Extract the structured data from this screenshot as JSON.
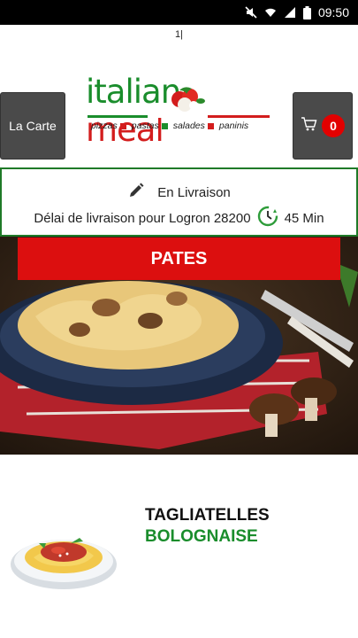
{
  "status_bar": {
    "time": "09:50"
  },
  "cursor_text": "1|",
  "header": {
    "menu_button_label": "La Carte",
    "cart_count": "0",
    "logo": {
      "word1": "italian",
      "word2": "meal",
      "tagline_items": [
        "pizzas",
        "pastas",
        "salades",
        "paninis"
      ]
    }
  },
  "delivery": {
    "mode_label": "En Livraison",
    "delay_text": "Délai de livraison pour Logron 28200",
    "delay_value": "45 Min"
  },
  "category": {
    "title": "PATES"
  },
  "product": {
    "name_line1": "TAGLIATELLES",
    "name_line2": "BOLOGNAISE"
  },
  "colors": {
    "brand_green": "#1a8d2c",
    "brand_red": "#dc0f0f",
    "button_grey": "#4a4a4a",
    "badge_red": "#e20000"
  }
}
